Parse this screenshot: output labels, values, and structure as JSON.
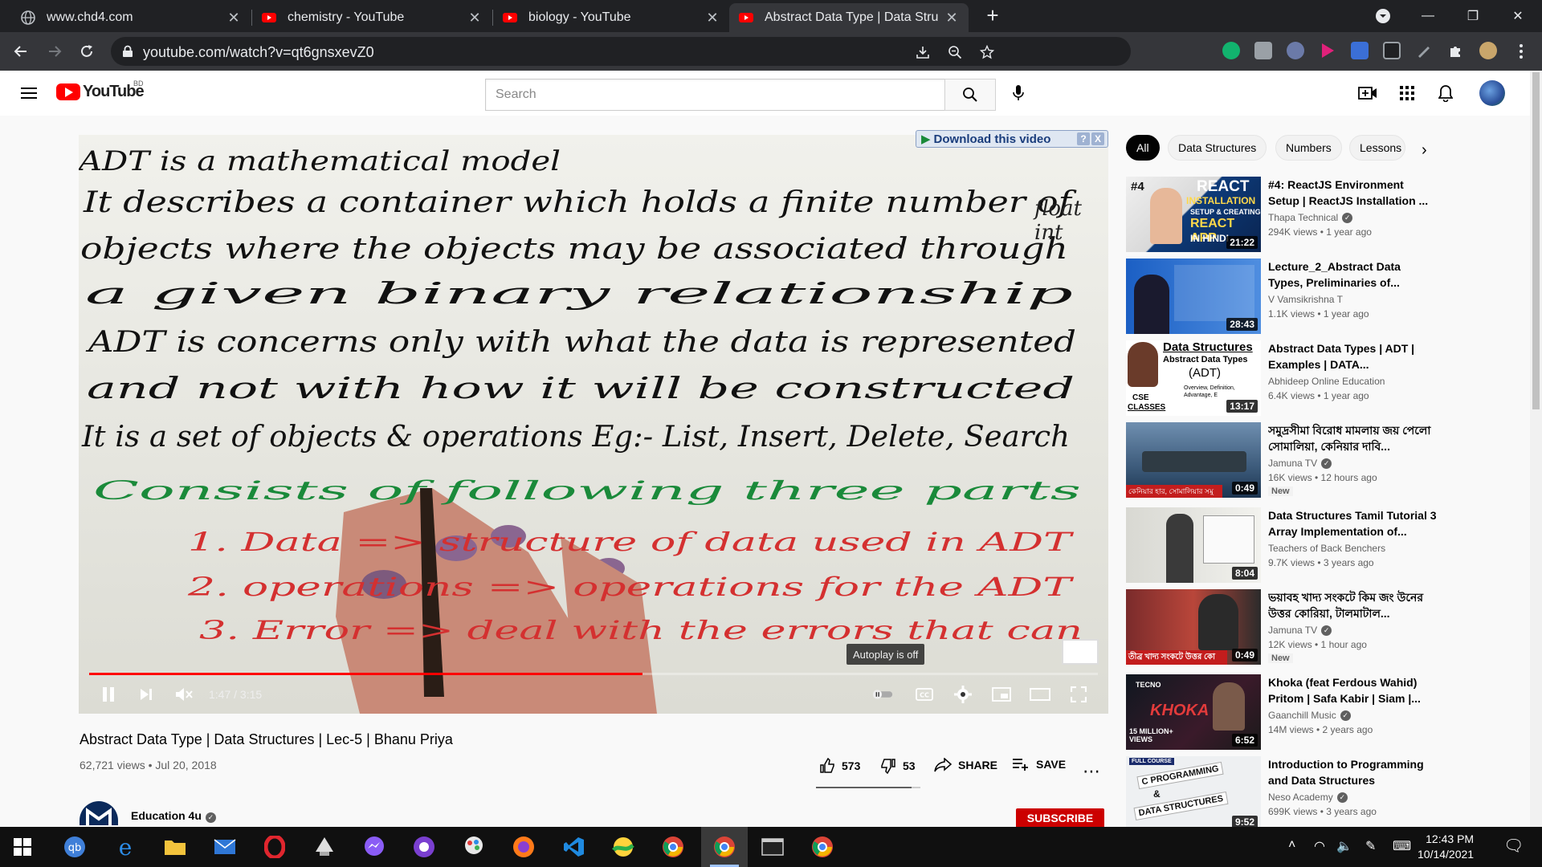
{
  "browser": {
    "tabs": [
      {
        "title": "www.chd4.com",
        "favicon": "globe-icon"
      },
      {
        "title": "chemistry - YouTube",
        "favicon": "youtube-icon"
      },
      {
        "title": "biology - YouTube",
        "favicon": "youtube-icon"
      },
      {
        "title": "Abstract Data Type | Data Structu",
        "favicon": "youtube-icon",
        "active": true
      }
    ],
    "url": "youtube.com/watch?v=qt6gnsxevZ0"
  },
  "youtube": {
    "logo_text": "YouTube",
    "country_code": "BD",
    "search_placeholder": "Search"
  },
  "player": {
    "download_bar": "Download this video",
    "download_help": "?",
    "download_close": "X",
    "autoplay_tooltip": "Autoplay is off",
    "time": "1:47 / 3:15",
    "progress_fraction": 0.5487,
    "whiteboard_lines": [
      "ADT is a mathematical model",
      "It describes a container which holds a finite number of",
      "objects where the objects may be associated through",
      "a given binary relationship",
      "ADT is concerns only with what the data is represented",
      "and not with how it will be constructed",
      "It is a set of objects & operations Eg:- List, Insert, Delete, Search",
      "Consists of following three parts",
      "1. Data => structure of data used in ADT",
      "2. operations => operations for the ADT",
      "3. Error => deal with the errors that can"
    ],
    "whiteboard_side_note": [
      "float",
      "int"
    ]
  },
  "video": {
    "title": "Abstract Data Type | Data Structures | Lec-5 | Bhanu Priya",
    "stats": "62,721 views • Jul 20, 2018",
    "likes": "573",
    "dislikes": "53",
    "share_label": "SHARE",
    "save_label": "SAVE",
    "like_fraction": 0.9154,
    "channel_name": "Education 4u",
    "subscribe_label": "SUBSCRIBE"
  },
  "sidebar": {
    "chips": [
      "All",
      "Data Structures",
      "Numbers",
      "Lessons"
    ],
    "recommendations": [
      {
        "title": "#4: ReactJS Environment Setup | ReactJS Installation ...",
        "channel": "Thapa Technical",
        "verified": true,
        "meta": "294K views • 1 year ago",
        "duration": "21:22",
        "thumb_text": [
          "#4",
          "REACT",
          "INSTALLATION",
          "SETUP & CREATING",
          "REACT APP",
          "IN HINDI"
        ]
      },
      {
        "title": "Lecture_2_Abstract Data Types, Preliminaries of...",
        "channel": "V Vamsikrishna T",
        "verified": false,
        "meta": "1.1K views • 1 year ago",
        "duration": "28:43"
      },
      {
        "title": "Abstract Data Types | ADT | Examples | DATA...",
        "channel": "Abhideep Online Education",
        "verified": false,
        "meta": "6.4K views • 1 year ago",
        "duration": "13:17",
        "thumb_text": [
          "Data Structures",
          "Abstract Data Types",
          "(ADT)",
          "Overview, Definition,",
          "Advantage, E",
          "CSE",
          "CLASSES"
        ]
      },
      {
        "title": "সমুদ্রসীমা বিরোধ মামলায় জয় পেলো সোমালিয়া, কেনিয়ার দাবি...",
        "channel": "Jamuna TV",
        "verified": true,
        "meta": "16K views • 12 hours ago",
        "badge": "New",
        "duration": "0:49",
        "thumb_text": [
          "কেনিয়ার হার, সোমালিয়ার সমু"
        ]
      },
      {
        "title": "Data Structures Tamil Tutorial 3 Array Implementation of...",
        "channel": "Teachers of Back Benchers",
        "verified": false,
        "meta": "9.7K views • 3 years ago",
        "duration": "8:04"
      },
      {
        "title": "ভয়াবহ খাদ্য সংকটে কিম জং উনের উত্তর কোরিয়া, টালমাটাল...",
        "channel": "Jamuna TV",
        "verified": true,
        "meta": "12K views • 1 hour ago",
        "badge": "New",
        "duration": "0:49",
        "thumb_text": [
          "তীব্র খাদ্য সংকটে উত্তর কো"
        ]
      },
      {
        "title": "Khoka (feat Ferdous Wahid) Pritom | Safa Kabir | Siam |...",
        "channel": "Gaanchill Music",
        "verified": true,
        "meta": "14M views • 2 years ago",
        "duration": "6:52",
        "thumb_text": [
          "TECNO",
          "KHOKA",
          "15 MILLION+ VIEWS"
        ]
      },
      {
        "title": "Introduction to Programming and Data Structures",
        "channel": "Neso Academy",
        "verified": true,
        "meta": "699K views • 3 years ago",
        "duration": "9:52",
        "thumb_text": [
          "FULL COURSE",
          "C PROGRAMMING",
          "&",
          "DATA STRUCTURES"
        ]
      }
    ]
  },
  "taskbar": {
    "time": "12:43 PM",
    "date": "10/14/2021"
  },
  "colors": {
    "yt_red": "#ff0000",
    "subscribe_red": "#cc0000",
    "chrome_dark": "#202124",
    "chrome_toolbar": "#35363a",
    "marker_black": "#111111",
    "marker_green": "#1a8a3a",
    "marker_blue": "#1f47c8",
    "marker_red": "#d43030"
  }
}
